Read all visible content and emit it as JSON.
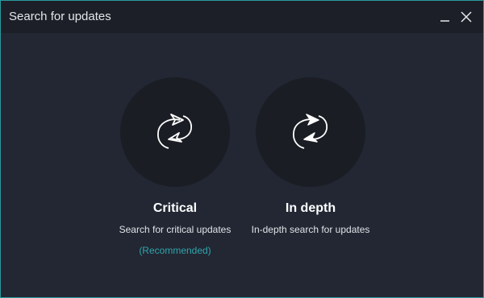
{
  "window": {
    "title": "Search for updates",
    "accent_color": "#2a9a9e",
    "minimize_icon": "minimize-icon",
    "close_icon": "close-icon"
  },
  "options": [
    {
      "title": "Critical",
      "description": "Search for critical updates",
      "note": "(Recommended)",
      "icon": "refresh-outline-icon"
    },
    {
      "title": "In depth",
      "description": "In-depth search for updates",
      "icon": "refresh-filled-icon"
    }
  ],
  "note_color": "#2fa6ad"
}
